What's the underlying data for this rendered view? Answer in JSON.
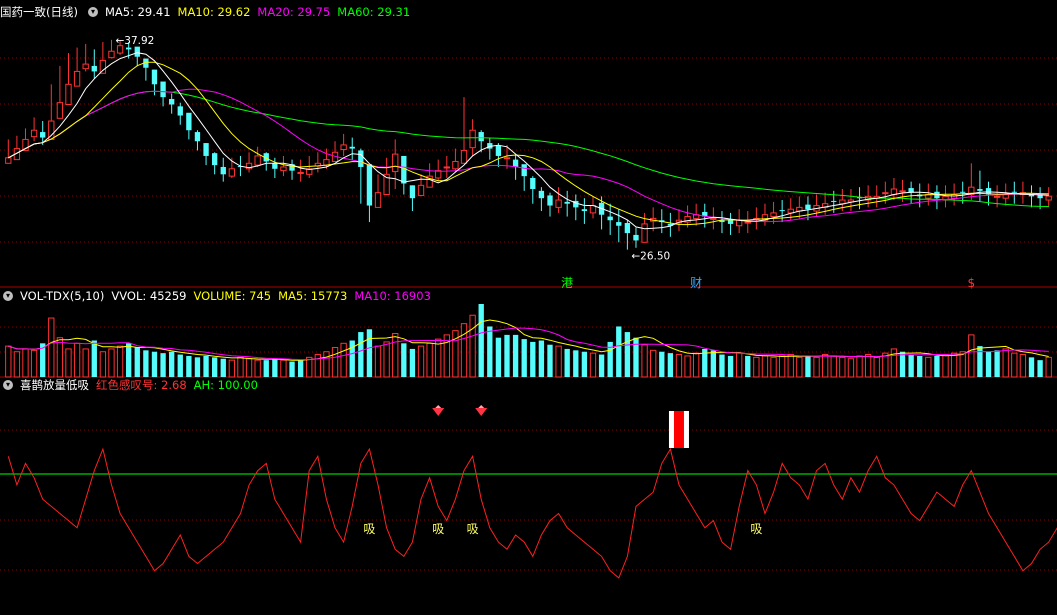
{
  "price_panel": {
    "title": "国药一致(日线)",
    "indicators": [
      {
        "label": "MA5: 29.41",
        "color": "#ffffff"
      },
      {
        "label": "MA10: 29.62",
        "color": "#ffff00"
      },
      {
        "label": "MA20: 29.75",
        "color": "#ff00ff"
      },
      {
        "label": "MA60: 29.31",
        "color": "#00ff00"
      }
    ],
    "high_label": "37.92",
    "low_label": "26.50",
    "markers": [
      {
        "text": "港",
        "color": "#00ff00",
        "index": 65
      },
      {
        "text": "财",
        "color": "#33aaff",
        "index": 80
      },
      {
        "text": "$",
        "color": "#ff3333",
        "index": 112
      }
    ]
  },
  "volume_panel": {
    "title": "VOL-TDX(5,10)",
    "indicators": [
      {
        "label": "VVOL: 45259",
        "color": "#ffffff"
      },
      {
        "label": "VOLUME: 745",
        "color": "#ffff00"
      },
      {
        "label": "MA5: 15773",
        "color": "#ffff00"
      },
      {
        "label": "MA10: 16903",
        "color": "#ff00ff"
      }
    ]
  },
  "signal_panel": {
    "title": "喜鹊放量低吸",
    "indicators": [
      {
        "label": "红色感叹号: 2.68",
        "color": "#ff3333"
      },
      {
        "label": "AH: 100.00",
        "color": "#00ff00"
      }
    ],
    "xi_text": "吸",
    "xi_positions": [
      42,
      50,
      54,
      87
    ],
    "gem_positions": [
      50,
      55
    ],
    "bar_position": 78
  },
  "colors": {
    "up": "#ff3333",
    "down": "#54fcfc",
    "ma5": "#ffffff",
    "ma10": "#ffff00",
    "ma20": "#ff00ff",
    "ma60": "#00ff00",
    "signal_line": "#ff2020",
    "ah_line": "#00ff00",
    "gridline": "#8b0000",
    "separator": "#b00000",
    "xi_color": "#ffff66"
  },
  "chart_data": {
    "type": "candlestick",
    "ylim": [
      25.5,
      39.0
    ],
    "closes": [
      31.5,
      32.0,
      32.5,
      33.0,
      32.6,
      33.5,
      34.5,
      35.5,
      36.2,
      36.6,
      36.2,
      36.8,
      37.3,
      37.6,
      37.4,
      37.0,
      36.4,
      35.5,
      34.8,
      34.4,
      33.8,
      33.0,
      32.4,
      31.6,
      31.1,
      30.6,
      30.9,
      31.0,
      31.2,
      31.6,
      31.3,
      30.9,
      31.0,
      30.8,
      30.7,
      30.9,
      31.2,
      31.4,
      31.8,
      32.2,
      32.0,
      31.0,
      28.9,
      29.6,
      30.6,
      31.7,
      30.1,
      29.3,
      30.0,
      30.5,
      30.8,
      31.0,
      31.3,
      31.9,
      33.0,
      32.4,
      32.0,
      31.6,
      31.5,
      31.0,
      30.5,
      29.8,
      29.3,
      28.9,
      29.2,
      29.0,
      28.8,
      28.6,
      28.9,
      28.4,
      28.1,
      27.8,
      27.4,
      27.0,
      27.9,
      28.2,
      28.0,
      27.8,
      28.1,
      28.3,
      28.4,
      28.3,
      28.2,
      28.0,
      27.9,
      28.1,
      28.0,
      28.2,
      28.4,
      28.5,
      28.6,
      28.7,
      28.8,
      28.7,
      28.9,
      29.0,
      29.1,
      29.2,
      29.2,
      29.3,
      29.4,
      29.4,
      29.6,
      29.8,
      29.7,
      29.6,
      29.4,
      29.5,
      29.3,
      29.4,
      29.5,
      29.6,
      29.9,
      29.7,
      29.5,
      29.4,
      29.5,
      29.6,
      29.6,
      29.4,
      29.3,
      29.41
    ],
    "highs": [
      32.5,
      32.7,
      33.1,
      33.7,
      33.5,
      35.5,
      36.5,
      37.2,
      37.5,
      37.7,
      37.4,
      37.8,
      37.92,
      37.9,
      37.8,
      37.5,
      36.9,
      36.1,
      35.4,
      35.0,
      34.5,
      33.7,
      33.0,
      32.3,
      31.8,
      31.5,
      31.5,
      31.6,
      31.8,
      32.1,
      31.8,
      31.5,
      31.6,
      31.4,
      31.4,
      31.6,
      31.8,
      32.0,
      32.4,
      32.8,
      32.6,
      32.0,
      31.0,
      30.6,
      31.5,
      32.5,
      31.4,
      30.0,
      30.6,
      31.2,
      31.4,
      31.6,
      32.0,
      34.8,
      33.6,
      33.0,
      32.6,
      32.3,
      32.2,
      31.7,
      31.1,
      30.5,
      29.9,
      29.6,
      29.9,
      29.7,
      29.5,
      29.3,
      29.4,
      29.4,
      29.0,
      28.7,
      28.1,
      27.7,
      28.5,
      28.8,
      28.7,
      28.5,
      28.7,
      28.9,
      29.0,
      29.0,
      28.8,
      28.6,
      28.5,
      28.7,
      28.6,
      28.8,
      29.0,
      29.1,
      29.2,
      29.3,
      29.4,
      29.4,
      29.5,
      29.6,
      29.7,
      29.8,
      29.8,
      29.9,
      30.0,
      30.0,
      30.2,
      30.4,
      30.3,
      30.2,
      30.1,
      30.1,
      30.0,
      30.0,
      30.1,
      30.2,
      31.2,
      30.8,
      30.2,
      30.0,
      30.1,
      30.2,
      30.2,
      30.0,
      29.9,
      29.9
    ],
    "lows": [
      31.2,
      31.4,
      31.9,
      32.4,
      32.2,
      33.2,
      34.2,
      35.0,
      35.8,
      36.2,
      35.8,
      36.4,
      36.9,
      37.1,
      36.9,
      36.5,
      35.7,
      34.9,
      34.3,
      33.9,
      33.3,
      32.5,
      31.9,
      31.1,
      30.6,
      30.2,
      30.4,
      30.5,
      30.7,
      31.0,
      30.8,
      30.4,
      30.5,
      30.3,
      30.2,
      30.4,
      30.7,
      30.9,
      31.3,
      31.6,
      31.4,
      29.0,
      28.0,
      28.8,
      29.6,
      29.8,
      29.5,
      28.6,
      29.4,
      29.9,
      30.2,
      30.4,
      30.7,
      31.2,
      31.6,
      31.8,
      31.4,
      31.0,
      30.9,
      30.3,
      29.7,
      29.0,
      28.6,
      28.3,
      28.5,
      28.3,
      28.1,
      27.9,
      28.2,
      27.6,
      27.3,
      26.9,
      26.5,
      26.6,
      27.1,
      27.5,
      27.4,
      27.2,
      27.5,
      27.7,
      27.8,
      27.7,
      27.6,
      27.4,
      27.3,
      27.4,
      27.4,
      27.6,
      27.8,
      27.9,
      28.0,
      28.1,
      28.2,
      28.1,
      28.3,
      28.4,
      28.5,
      28.6,
      28.6,
      28.7,
      28.8,
      28.8,
      29.0,
      29.2,
      29.1,
      29.0,
      28.8,
      28.9,
      28.7,
      28.8,
      28.9,
      29.0,
      29.2,
      29.1,
      28.9,
      28.8,
      28.9,
      29.0,
      29.0,
      28.8,
      28.7,
      28.8
    ],
    "volumes": [
      22,
      18,
      20,
      19,
      24,
      42,
      28,
      20,
      24,
      20,
      26,
      18,
      20,
      22,
      24,
      21,
      19,
      18,
      17,
      18,
      16,
      15,
      14,
      15,
      14,
      13,
      12,
      14,
      13,
      12,
      12,
      13,
      12,
      11,
      12,
      14,
      16,
      18,
      21,
      24,
      26,
      32,
      34,
      22,
      25,
      31,
      24,
      20,
      22,
      24,
      27,
      30,
      33,
      38,
      44,
      52,
      36,
      28,
      30,
      30,
      27,
      25,
      26,
      23,
      22,
      20,
      19,
      18,
      17,
      16,
      25,
      36,
      32,
      28,
      23,
      19,
      18,
      17,
      16,
      15,
      17,
      20,
      19,
      16,
      15,
      17,
      15,
      14,
      15,
      14,
      15,
      16,
      14,
      15,
      14,
      16,
      15,
      14,
      13,
      15,
      16,
      14,
      17,
      20,
      18,
      16,
      15,
      14,
      15,
      16,
      17,
      18,
      30,
      22,
      18,
      19,
      20,
      17,
      16,
      14,
      12,
      14
    ],
    "signal": [
      90,
      70,
      85,
      75,
      60,
      55,
      50,
      45,
      40,
      60,
      80,
      95,
      70,
      50,
      40,
      30,
      20,
      10,
      15,
      25,
      35,
      20,
      15,
      20,
      25,
      30,
      40,
      50,
      70,
      80,
      85,
      60,
      50,
      40,
      30,
      80,
      90,
      60,
      40,
      30,
      55,
      85,
      95,
      70,
      40,
      25,
      20,
      30,
      60,
      75,
      55,
      45,
      60,
      80,
      90,
      60,
      40,
      30,
      25,
      35,
      30,
      20,
      35,
      45,
      50,
      40,
      35,
      30,
      25,
      20,
      10,
      5,
      20,
      55,
      60,
      65,
      85,
      95,
      70,
      60,
      50,
      40,
      45,
      30,
      25,
      55,
      80,
      70,
      50,
      65,
      85,
      75,
      70,
      60,
      80,
      85,
      70,
      60,
      75,
      65,
      80,
      90,
      75,
      70,
      60,
      50,
      45,
      55,
      65,
      60,
      55,
      70,
      80,
      65,
      50,
      40,
      30,
      20,
      10,
      15,
      25,
      30,
      40
    ]
  }
}
